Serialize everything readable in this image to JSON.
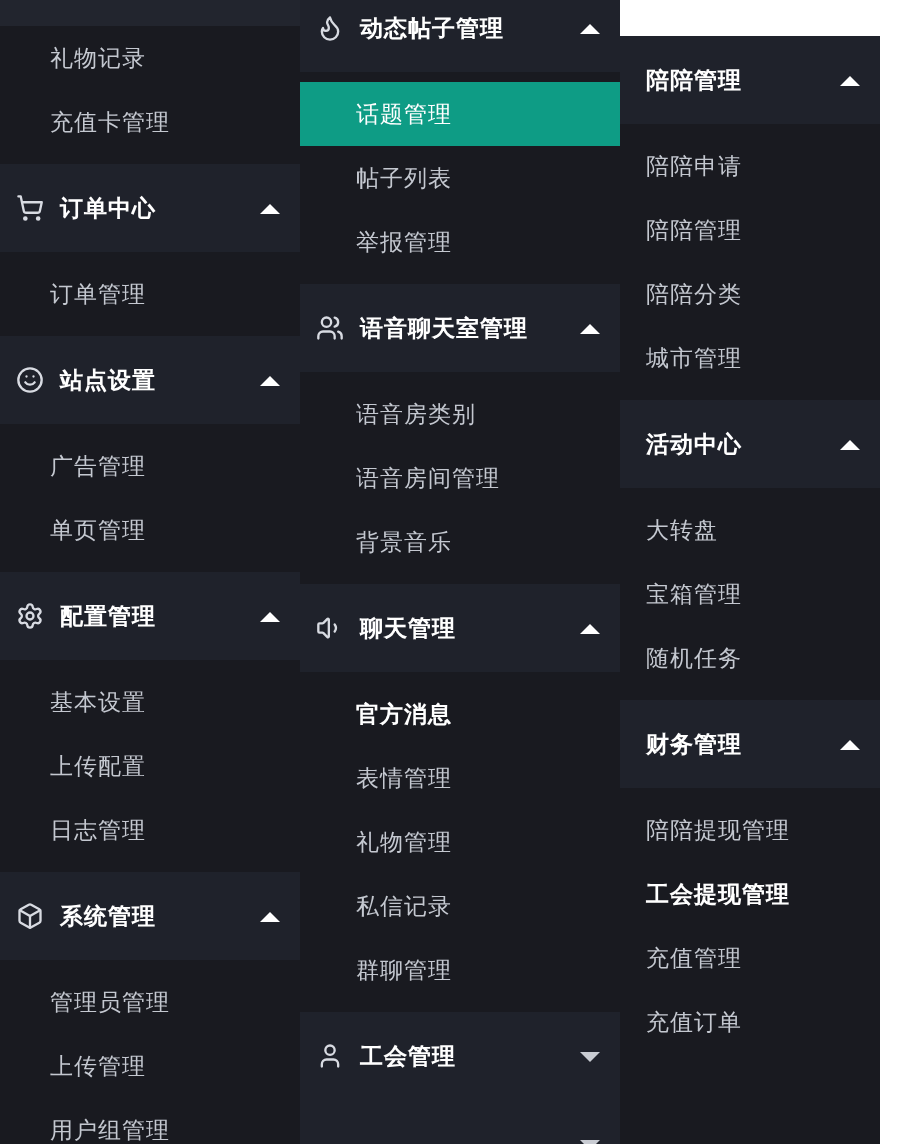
{
  "panels": [
    {
      "groups": [
        {
          "items": [
            {
              "label": "礼物记录",
              "selected": false,
              "emphasized": false
            },
            {
              "label": "充值卡管理",
              "selected": false,
              "emphasized": false
            }
          ]
        },
        {
          "title": "订单中心",
          "expanded": true,
          "items": [
            {
              "label": "订单管理",
              "selected": false,
              "emphasized": false
            }
          ]
        },
        {
          "title": "站点设置",
          "expanded": true,
          "items": [
            {
              "label": "广告管理",
              "selected": false,
              "emphasized": false
            },
            {
              "label": "单页管理",
              "selected": false,
              "emphasized": false
            }
          ]
        },
        {
          "title": "配置管理",
          "expanded": true,
          "items": [
            {
              "label": "基本设置",
              "selected": false,
              "emphasized": false
            },
            {
              "label": "上传配置",
              "selected": false,
              "emphasized": false
            },
            {
              "label": "日志管理",
              "selected": false,
              "emphasized": false
            }
          ]
        },
        {
          "title": "系统管理",
          "expanded": true,
          "items": [
            {
              "label": "管理员管理",
              "selected": false,
              "emphasized": false
            },
            {
              "label": "上传管理",
              "selected": false,
              "emphasized": false
            },
            {
              "label": "用户组管理",
              "selected": false,
              "emphasized": false
            }
          ]
        }
      ]
    },
    {
      "groups": [
        {
          "title": "动态帖子管理",
          "expanded": true,
          "items": [
            {
              "label": "话题管理",
              "selected": true,
              "emphasized": false
            },
            {
              "label": "帖子列表",
              "selected": false,
              "emphasized": false
            },
            {
              "label": "举报管理",
              "selected": false,
              "emphasized": false
            }
          ]
        },
        {
          "title": "语音聊天室管理",
          "expanded": true,
          "items": [
            {
              "label": "语音房类别",
              "selected": false,
              "emphasized": false
            },
            {
              "label": "语音房间管理",
              "selected": false,
              "emphasized": false
            },
            {
              "label": "背景音乐",
              "selected": false,
              "emphasized": false
            }
          ]
        },
        {
          "title": "聊天管理",
          "expanded": true,
          "items": [
            {
              "label": "官方消息",
              "selected": false,
              "emphasized": true
            },
            {
              "label": "表情管理",
              "selected": false,
              "emphasized": false
            },
            {
              "label": "礼物管理",
              "selected": false,
              "emphasized": false
            },
            {
              "label": "私信记录",
              "selected": false,
              "emphasized": false
            },
            {
              "label": "群聊管理",
              "selected": false,
              "emphasized": false
            }
          ]
        },
        {
          "title": "工会管理",
          "expanded": false
        },
        {
          "expanded": false
        }
      ]
    },
    {
      "groups": [
        {
          "title": "陪陪管理",
          "expanded": true,
          "items": [
            {
              "label": "陪陪申请",
              "selected": false,
              "emphasized": false
            },
            {
              "label": "陪陪管理",
              "selected": false,
              "emphasized": false
            },
            {
              "label": "陪陪分类",
              "selected": false,
              "emphasized": false
            },
            {
              "label": "城市管理",
              "selected": false,
              "emphasized": false
            }
          ]
        },
        {
          "title": "活动中心",
          "expanded": true,
          "items": [
            {
              "label": "大转盘",
              "selected": false,
              "emphasized": false
            },
            {
              "label": "宝箱管理",
              "selected": false,
              "emphasized": false
            },
            {
              "label": "随机任务",
              "selected": false,
              "emphasized": false
            }
          ]
        },
        {
          "title": "财务管理",
          "expanded": true,
          "items": [
            {
              "label": "陪陪提现管理",
              "selected": false,
              "emphasized": false
            },
            {
              "label": "工会提现管理",
              "selected": false,
              "emphasized": true
            },
            {
              "label": "充值管理",
              "selected": false,
              "emphasized": false
            },
            {
              "label": "充值订单",
              "selected": false,
              "emphasized": false
            }
          ]
        }
      ]
    }
  ]
}
